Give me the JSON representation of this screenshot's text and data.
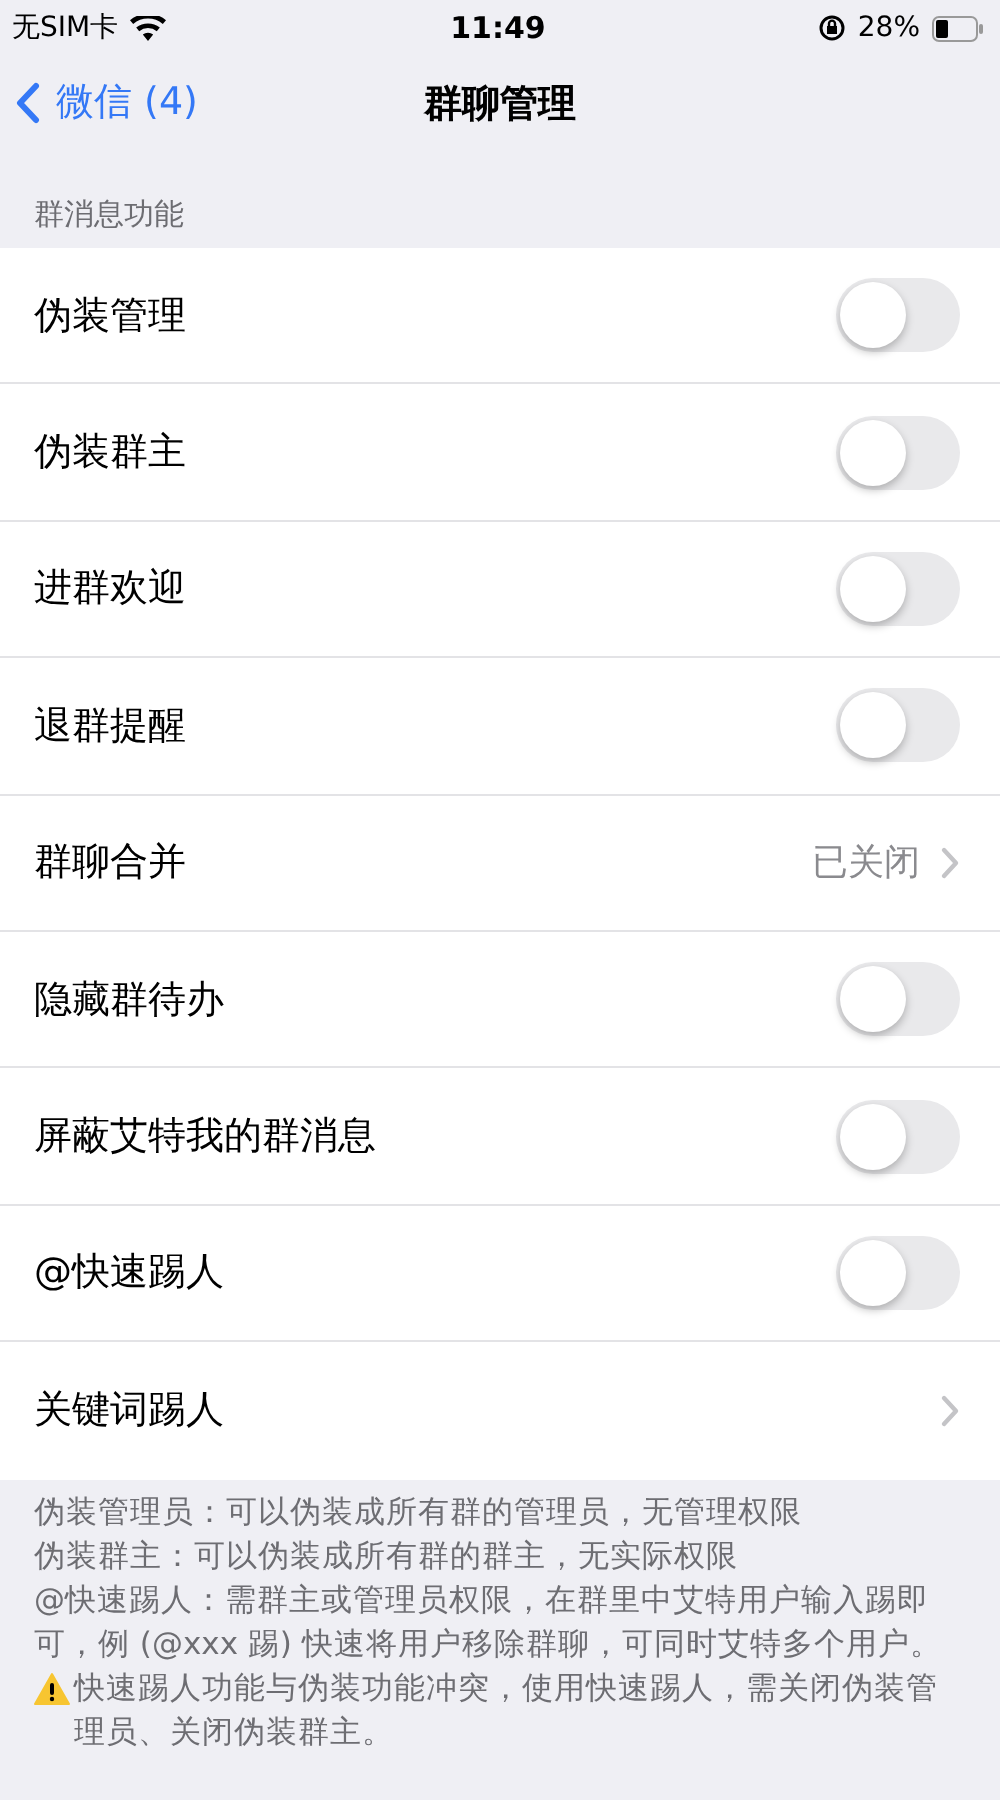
{
  "status_bar": {
    "carrier": "无SIM卡",
    "time": "11:49",
    "battery": "28%"
  },
  "nav": {
    "back": "微信 (4)",
    "title": "群聊管理"
  },
  "section": {
    "header": "群消息功能",
    "items": [
      {
        "kind": "toggle",
        "label": "伪装管理",
        "on": false
      },
      {
        "kind": "toggle",
        "label": "伪装群主",
        "on": false
      },
      {
        "kind": "toggle",
        "label": "进群欢迎",
        "on": false
      },
      {
        "kind": "toggle",
        "label": "退群提醒",
        "on": false
      },
      {
        "kind": "link",
        "label": "群聊合并",
        "value": "已关闭"
      },
      {
        "kind": "toggle",
        "label": "隐藏群待办",
        "on": false
      },
      {
        "kind": "toggle",
        "label": "屏蔽艾特我的群消息",
        "on": false
      },
      {
        "kind": "toggle",
        "label": "@快速踢人",
        "on": false
      },
      {
        "kind": "link",
        "label": "关键词踢人"
      }
    ]
  },
  "notes": [
    {
      "kind": "plain",
      "text": "伪装管理员：可以伪装成所有群的管理员，无管理权限"
    },
    {
      "kind": "plain",
      "text": "伪装群主：可以伪装成所有群的群主，无实际权限"
    },
    {
      "kind": "plain",
      "text": "@快速踢人：需群主或管理员权限，在群里中艾特用户输入踢即可，例 (@xxx 踢) 快速将用户移除群聊，可同时艾特多个用户。"
    },
    {
      "kind": "warning",
      "text": "快速踢人功能与伪装功能冲突，使用快速踢人，需关闭伪装管理员、关闭伪装群主。"
    }
  ]
}
